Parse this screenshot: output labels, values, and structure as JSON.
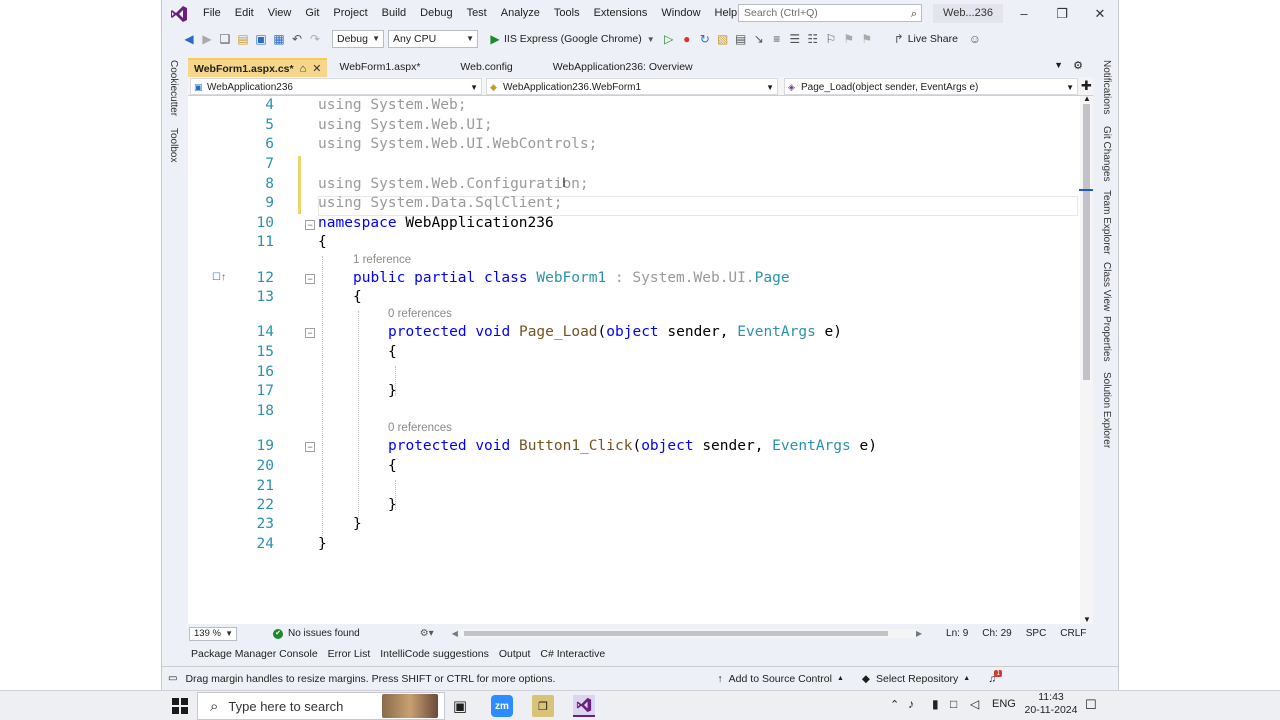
{
  "menubar": {
    "items": [
      "File",
      "Edit",
      "View",
      "Git",
      "Project",
      "Build",
      "Debug",
      "Test",
      "Analyze",
      "Tools",
      "Extensions",
      "Window",
      "Help"
    ],
    "search_placeholder": "Search (Ctrl+Q)",
    "solution_title": "Web...236"
  },
  "toolbar": {
    "config": "Debug",
    "platform": "Any CPU",
    "run_target": "IIS Express (Google Chrome)",
    "live_share": "Live Share"
  },
  "left_rail": [
    "Cookiecutter",
    "Toolbox"
  ],
  "right_rail": [
    "Notifications",
    "Git Changes",
    "Team Explorer",
    "Class View",
    "Properties",
    "Solution Explorer"
  ],
  "tabs": [
    {
      "label": "WebForm1.aspx.cs*",
      "active": true
    },
    {
      "label": "WebForm1.aspx*",
      "active": false
    },
    {
      "label": "Web.config",
      "active": false
    },
    {
      "label": "WebApplication236: Overview",
      "active": false
    }
  ],
  "navbar": {
    "project": "WebApplication236",
    "type": "WebApplication236.WebForm1",
    "member": "Page_Load(object sender, EventArgs e)"
  },
  "code": {
    "line_numbers": [
      "4",
      "5",
      "6",
      "7",
      "8",
      "9",
      "10",
      "11",
      "12",
      "13",
      "14",
      "15",
      "16",
      "17",
      "18",
      "19",
      "20",
      "21",
      "22",
      "23",
      "24"
    ],
    "using_kw": "using",
    "l4": "System.Web;",
    "l5": "System.Web.UI;",
    "l6": "System.Web.UI.WebControls;",
    "l8": "System.Web.Configuration;",
    "l9": "System.Data.SqlClient;",
    "namespace_kw": "namespace",
    "namespace_name": "WebApplication236",
    "open_brace": "{",
    "close_brace": "}",
    "class_refs": "1 reference",
    "class_decl": {
      "public": "public",
      "partial": "partial",
      "class": "class",
      "name": "WebForm1",
      "colon": " : ",
      "base_ns": "System.Web.UI.",
      "base": "Page"
    },
    "method_refs": "0 references",
    "protected": "protected",
    "void": "void",
    "page_load": "Page_Load",
    "button_click": "Button1_Click",
    "params_open": "(",
    "object": "object",
    "sender": " sender, ",
    "eventargs": "EventArgs",
    "e": " e)"
  },
  "editor_status": {
    "zoom": "139 %",
    "issues": "No issues found",
    "line": "Ln: 9",
    "col": "Ch: 29",
    "spc": "SPC",
    "crlf": "CRLF"
  },
  "tool_windows": [
    "Package Manager Console",
    "Error List",
    "IntelliCode suggestions",
    "Output",
    "C# Interactive"
  ],
  "statusbar": {
    "message": "Drag margin handles to resize margins. Press SHIFT or CTRL for more options.",
    "source_control": "Add to Source Control",
    "repository": "Select Repository",
    "notifications": "1"
  },
  "taskbar": {
    "search_placeholder": "Type here to search",
    "lang": "ENG",
    "time": "11:43",
    "date": "20-11-2024"
  },
  "colors": {
    "accent": "#68217a",
    "tab_active": "#f6d68a",
    "keyword": "#0000ff",
    "type": "#2b91af"
  }
}
